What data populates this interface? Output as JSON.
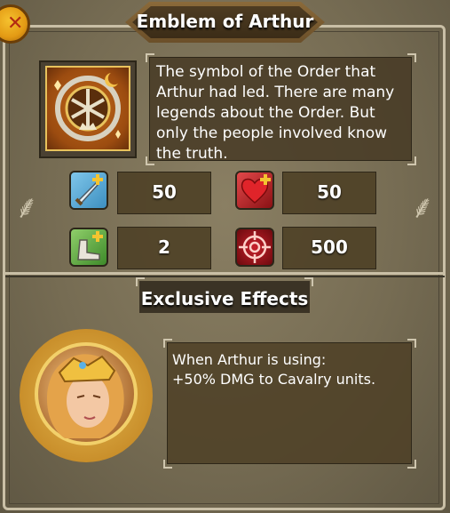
{
  "title": "Emblem of Arthur",
  "close_icon": "close-icon",
  "description": "The symbol of the Order that Arthur had led. There are many legends about the Order. But only the people involved know the truth.",
  "stats": [
    {
      "name": "attack",
      "icon": "sword-plus-icon",
      "value": "50"
    },
    {
      "name": "health",
      "icon": "heart-plus-icon",
      "value": "50"
    },
    {
      "name": "speed",
      "icon": "boot-plus-icon",
      "value": "2"
    },
    {
      "name": "accuracy",
      "icon": "target-icon",
      "value": "500"
    }
  ],
  "exclusive": {
    "heading": "Exclusive Effects",
    "text_line1": "When Arthur is using:",
    "text_line2": "+50% DMG to Cavalry units."
  },
  "colors": {
    "panel": "#766c53",
    "frame": "#c9bfa6",
    "text": "#ffffff",
    "close_button": "#e39a14"
  }
}
